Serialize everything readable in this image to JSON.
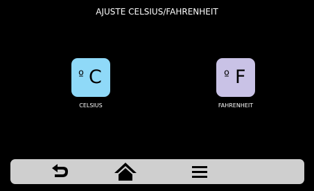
{
  "screen": {
    "title": "AJUSTE CELSIUS/FAHRENHEIT"
  },
  "options": {
    "celsius": {
      "degree_symbol": "º",
      "letter": "C",
      "label": "CELSIUS",
      "color": "#8fd9f8"
    },
    "fahrenheit": {
      "degree_symbol": "º",
      "letter": "F",
      "label": "FAHRENHEIT",
      "color": "#c9c2e6"
    }
  },
  "nav_bar": {
    "background": "#cfcfcf",
    "buttons": [
      {
        "icon": "back-arrow-icon"
      },
      {
        "icon": "home-icon"
      },
      {
        "icon": "menu-icon"
      }
    ]
  }
}
